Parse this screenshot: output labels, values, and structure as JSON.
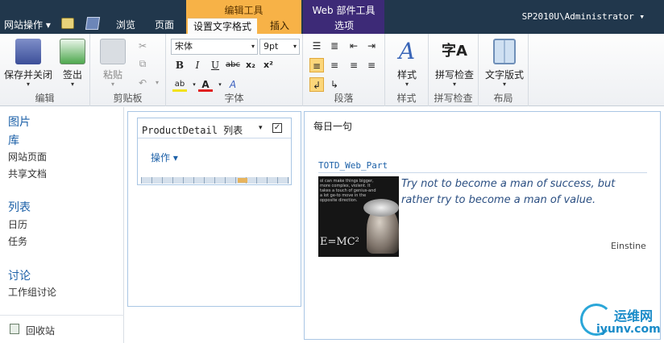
{
  "topbar": {
    "site_actions": "网站操作",
    "tab_browse": "浏览",
    "tab_page": "页面",
    "ctx_edit_tools": "编辑工具",
    "tab_format_text": "设置文字格式",
    "tab_insert": "插入",
    "ctx_webpart_tools": "Web 部件工具",
    "tab_options": "选项",
    "user": "SP2010U\\Administrator"
  },
  "ribbon": {
    "edit": {
      "save_close": "保存并关闭",
      "checkout": "签出",
      "group": "编辑"
    },
    "clipboard": {
      "paste": "粘贴",
      "group": "剪贴板"
    },
    "font": {
      "font_name": "宋体",
      "font_size": "9pt",
      "group": "字体"
    },
    "paragraph": {
      "group": "段落"
    },
    "styles": {
      "styles": "样式",
      "group": "样式"
    },
    "spelling": {
      "spell_check": "拼写检查",
      "group": "拼写检查"
    },
    "layout": {
      "text_layout": "文字版式",
      "group": "布局"
    }
  },
  "nav": {
    "pictures": "图片",
    "libraries": "库",
    "site_pages": "网站页面",
    "shared_docs": "共享文档",
    "lists": "列表",
    "calendar": "日历",
    "tasks": "任务",
    "discussions": "讨论",
    "team_discussion": "工作组讨论",
    "recycle_bin": "回收站"
  },
  "list_webpart": {
    "title": "ProductDetail 列表",
    "actions": "操作"
  },
  "quote_webpart": {
    "zone_title": "每日一句",
    "part_title": "TOTD_Web_Part",
    "quote": "Try not to become a man of success, but rather try to become a man of value.",
    "author": "Einstine",
    "image_caption": "ol can make things bigger, more complex, violent. It takes a touch of genius-and a lot ge-to move in the opposite direction.",
    "image_formula": "E=MC²"
  },
  "watermark": {
    "brand": "运维网",
    "url": "iyunv.com"
  },
  "colors": {
    "topbar": "#21374c",
    "edit_ctx": "#f7b247",
    "web_ctx": "#3d2a77",
    "link": "#1d61a8"
  }
}
